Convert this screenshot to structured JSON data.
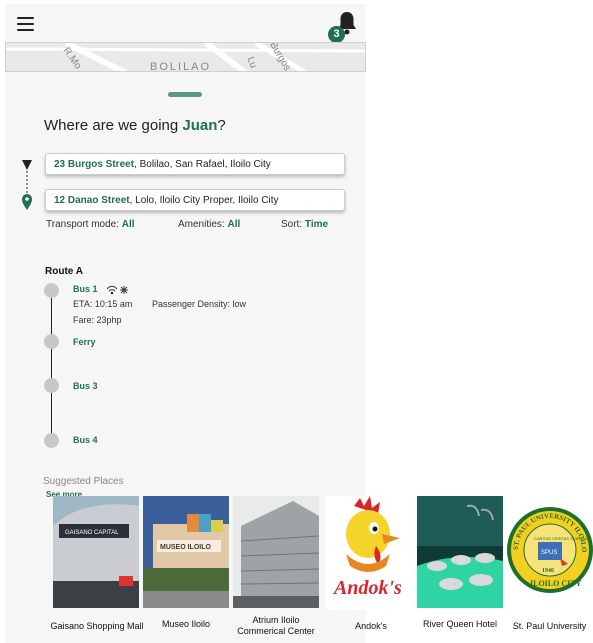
{
  "header": {
    "menu_icon": "hamburger-menu-icon",
    "bell_icon": "bell-icon",
    "notification_count": "3"
  },
  "map": {
    "labels": [
      "R.Mo",
      "BOLILAO",
      "Lu",
      "Burgos"
    ]
  },
  "greeting": {
    "prefix": "Where are we going ",
    "name": "Juan",
    "suffix": "?"
  },
  "origin": {
    "street": "23 Burgos Street",
    "rest": ", Bolilao, San Rafael, Iloilo City"
  },
  "destination": {
    "street": "12 Danao Street",
    "rest": ", Lolo, Iloilo City Proper, Iloilo City"
  },
  "filters": {
    "transport_label": "Transport mode: ",
    "transport_value": "All",
    "amenities_label": "Amenities: ",
    "amenities_value": "All",
    "sort_label": "Sort: ",
    "sort_value": "Time"
  },
  "route": {
    "title": "Route A",
    "stops": [
      "Bus 1",
      "Ferry",
      "Bus 3",
      "Bus 4"
    ],
    "eta": "ETA: 10:15 am",
    "density": "Passenger Density: low",
    "fare": "Fare: 23php"
  },
  "suggested": {
    "title": "Suggested Places",
    "see_more": "See more",
    "places": [
      "Gaisano Shopping Mall",
      "Museo Iloilo",
      "Atrium Iloilo",
      "Commerical Center",
      "Andok's",
      "River Queen Hotel",
      "St. Paul University"
    ],
    "image_text": {
      "gaisano": "GAISANO CAPITAL",
      "museo": "MUSEO ILOILO",
      "andoks": "Andok's",
      "seal_top": "ST. PAUL UNIVERSITY ILOILO",
      "seal_bottom": "ILOILO CITY",
      "seal_year": "1946",
      "seal_center": "SPUS",
      "seal_motto": "CARITAS VERITAS SCIENTIA"
    }
  }
}
